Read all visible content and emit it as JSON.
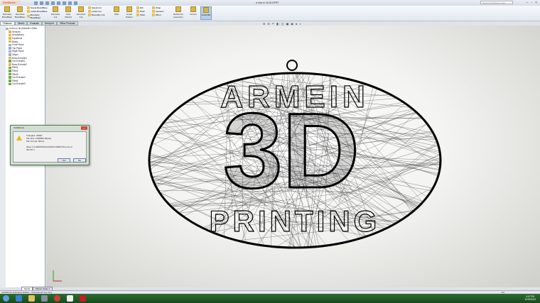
{
  "window": {
    "app": "SolidWorks",
    "title": "a new in 3d.SLDPRT",
    "search_placeholder": "Search SolidWorks Help",
    "controls": [
      "–",
      "▫",
      "×"
    ]
  },
  "ribbon": {
    "buttons": [
      "Extruded Boss/Base",
      "Revolved Boss/Base"
    ],
    "col1": [
      "Swept Boss/Base",
      "Lofted Boss/Base",
      "Boundary Boss/Base"
    ],
    "buttons2": [
      "Extruded Cut",
      "Hole Wizard",
      "Revolved Cut"
    ],
    "col2": [
      "Swept Cut",
      "Lofted Cut",
      "Boundary Cut"
    ],
    "buttons3": [
      "Fillet",
      "Linear Pattern"
    ],
    "col3": [
      "Rib",
      "Draft",
      "Shell"
    ],
    "col4": [
      "Wrap",
      "Intersect",
      "Mirror"
    ],
    "buttons4": [
      "Reference Geometry",
      "Curves",
      "Instant3D"
    ]
  },
  "cm_tabs": [
    "Features",
    "Sketch",
    "Evaluate",
    "DimXpert",
    "Office Products"
  ],
  "tree": {
    "root": "a new in 3d (Default<<Defa",
    "items": [
      {
        "label": "Sensors",
        "t": "y"
      },
      {
        "label": "Annotations",
        "t": "y"
      },
      {
        "label": "Equations",
        "t": "y"
      },
      {
        "label": "Brass",
        "t": "y"
      },
      {
        "label": "Front Plane",
        "t": "p"
      },
      {
        "label": "Top Plane",
        "t": "p"
      },
      {
        "label": "Right Plane",
        "t": "p"
      },
      {
        "label": "Origin",
        "t": "p"
      },
      {
        "label": "Boss-Extrude1",
        "t": "y"
      },
      {
        "label": "Cut-Extrude1",
        "t": "g"
      },
      {
        "label": "Boss-Extrude2",
        "t": "y"
      },
      {
        "label": "Fillet1",
        "t": "g"
      },
      {
        "label": "Fillet2",
        "t": "g"
      },
      {
        "label": "Fillet3",
        "t": "g"
      },
      {
        "label": "Cut-Extrude2",
        "t": "g"
      },
      {
        "label": "Fillet4",
        "t": "g"
      },
      {
        "label": "Cut-Extrude3",
        "t": "g"
      }
    ]
  },
  "dialog": {
    "title": "SolidWorks",
    "lines": [
      "Triangles: 44960",
      "File Size: 2248084 (Bytes)",
      "File Format: Binary",
      "",
      "Save C:\\USERS\\PAGAN\\DOCUMENTS\\a new in",
      "3D.STL?"
    ],
    "yes": "Yes",
    "no": "No"
  },
  "model": {
    "top_text": "ARMEIN",
    "center_text": "3D",
    "bottom_text": "PRINTING"
  },
  "bottom_tabs": [
    "Model",
    "Motion Study 1"
  ],
  "status": {
    "left": "SolidWorks Education Edition - Instructional Use Only",
    "zoom": "0%"
  },
  "clock": {
    "time": "4:47 PM",
    "date": "11/20/2013"
  }
}
